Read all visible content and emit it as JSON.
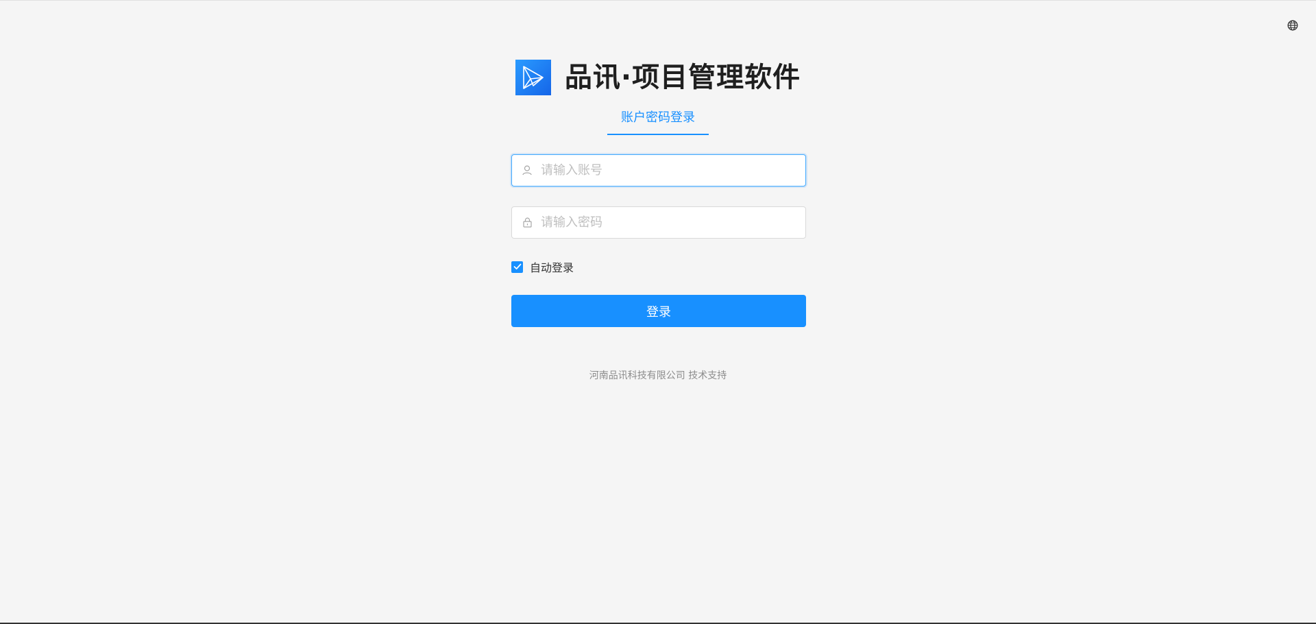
{
  "header": {
    "title": "品讯·项目管理软件",
    "logo_icon": "paper-plane-logo-icon"
  },
  "language": {
    "icon": "globe-icon"
  },
  "tabs": [
    {
      "label": "账户密码登录",
      "active": true
    }
  ],
  "form": {
    "account": {
      "icon": "user-icon",
      "placeholder": "请输入账号",
      "value": ""
    },
    "password": {
      "icon": "lock-icon",
      "placeholder": "请输入密码",
      "value": ""
    },
    "remember": {
      "label": "自动登录",
      "checked": true
    },
    "submit_label": "登录"
  },
  "footer": {
    "text": "河南品讯科技有限公司 技术支持"
  },
  "colors": {
    "primary": "#1890ff",
    "background": "#f5f5f5",
    "title": "#1f1f1f",
    "footer_text": "#8c8c8c"
  }
}
